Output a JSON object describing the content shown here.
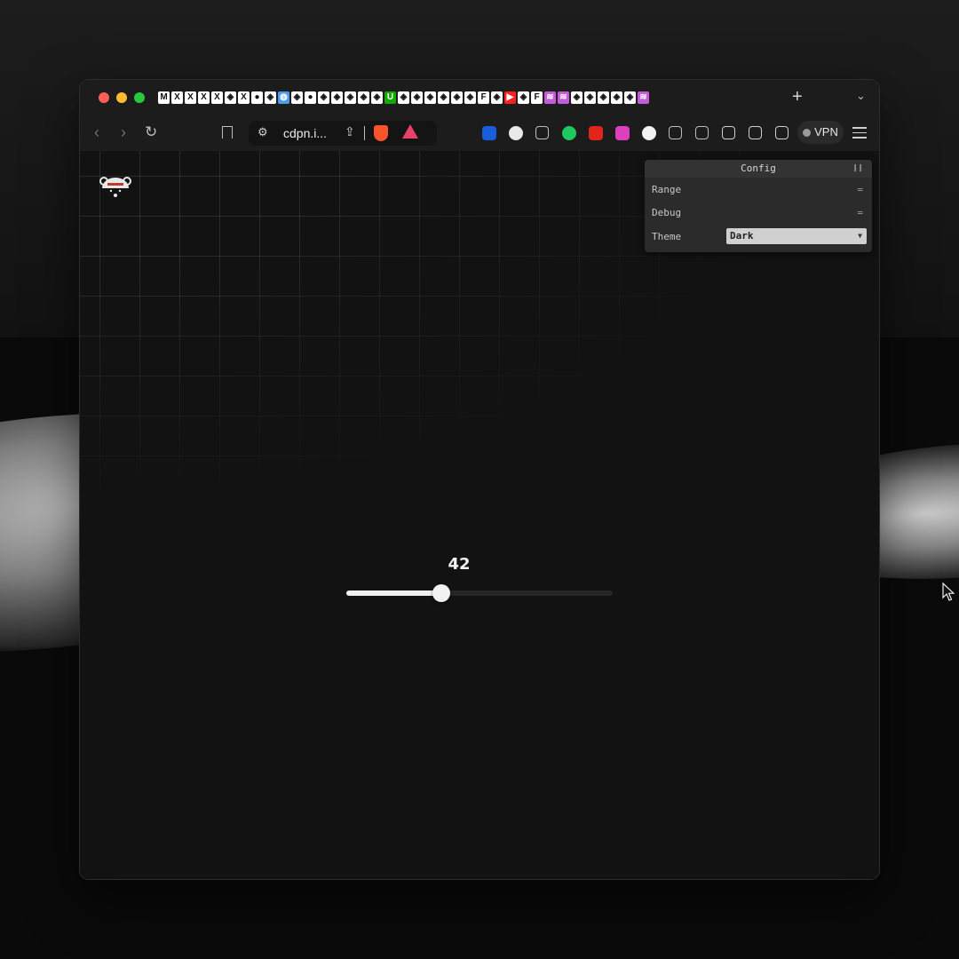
{
  "browser": {
    "url": "cdpn.i...",
    "new_tab_label": "+",
    "tab_list_label": "⌄",
    "vpn_label": "VPN",
    "tab_icons": [
      "gmail",
      "x",
      "x",
      "x",
      "x",
      "codepen",
      "x",
      "github",
      "codepen",
      "chrome",
      "codepen",
      "github",
      "codepen",
      "codepen",
      "codepen",
      "codepen",
      "codepen",
      "upwork",
      "codepen",
      "codepen",
      "codepen",
      "codepen",
      "codepen",
      "codepen",
      "figma",
      "codepen",
      "youtube",
      "codepen",
      "framer",
      "stack",
      "stack",
      "codepen",
      "codepen",
      "codepen",
      "codepen",
      "codepen",
      "stack"
    ]
  },
  "extensions": [
    "bitwarden-icon",
    "pencil-icon",
    "leaf-icon",
    "green-dot-icon",
    "ublock-icon",
    "grammarly-icon",
    "m-icon",
    "feather-icon",
    "puzzle-icon",
    "sidebar-icon",
    "wallet-icon",
    "leo-icon"
  ],
  "slider": {
    "value": "42",
    "min": 0,
    "max": 100,
    "fraction": 0.42
  },
  "config": {
    "title": "Config",
    "rows": [
      {
        "label": "Range"
      },
      {
        "label": "Debug"
      }
    ],
    "theme_label": "Theme",
    "theme_value": "Dark"
  },
  "colors": {
    "accent": "#f0f0f0",
    "panel": "#2b2b2b",
    "background": "#121212"
  }
}
